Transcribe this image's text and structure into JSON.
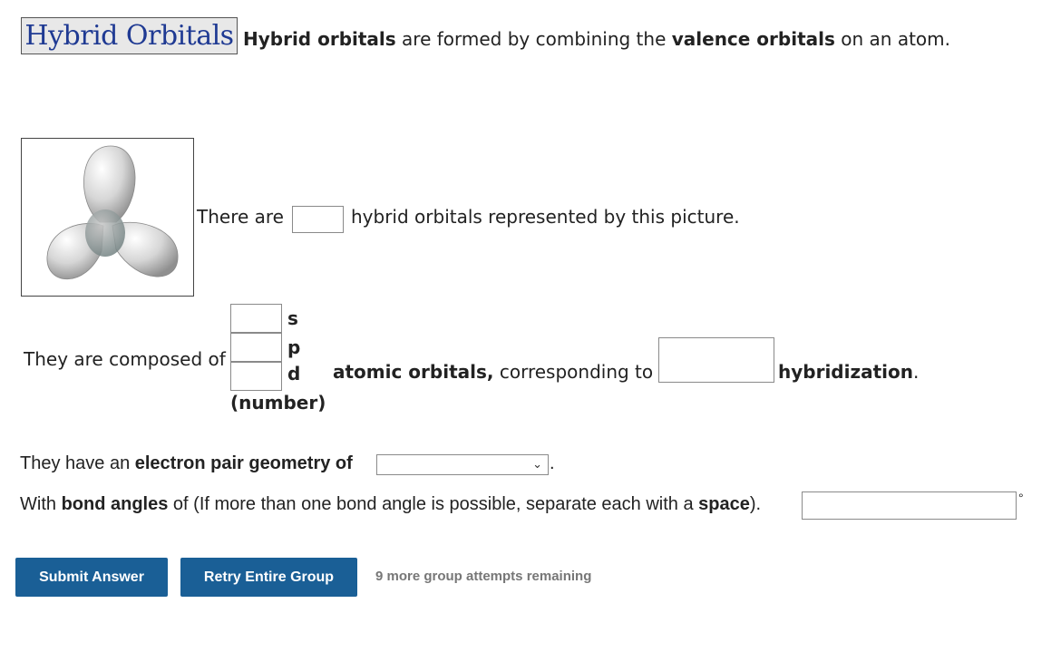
{
  "header": {
    "title": "Hybrid Orbitals",
    "intro_bold_1": "Hybrid orbitals",
    "intro_text_1": " are formed by combining the ",
    "intro_bold_2": "valence orbitals",
    "intro_text_2": " on an atom."
  },
  "q1": {
    "before": "There are",
    "after": "hybrid orbitals represented by this picture.",
    "value": ""
  },
  "q2": {
    "lead": "They are composed of",
    "s_label": "s",
    "p_label": "p",
    "d_label": "d",
    "number_label": "(number)",
    "atomic_bold": "atomic orbitals,",
    "corresponding": " corresponding to",
    "hybridization": "hybridization",
    "period": ".",
    "s_value": "",
    "p_value": "",
    "d_value": "",
    "hyb_value": ""
  },
  "q3": {
    "before": "They have an ",
    "bold": "electron pair geometry of",
    "after": ".",
    "selected": ""
  },
  "q4": {
    "before": "With ",
    "bold1": "bond angles",
    "middle": " of (If more than one bond angle is possible, separate each with a ",
    "bold2": "space",
    "after": ").",
    "unit": "°",
    "value": ""
  },
  "actions": {
    "submit": "Submit Answer",
    "retry": "Retry Entire Group",
    "remaining": "9 more group attempts remaining"
  }
}
